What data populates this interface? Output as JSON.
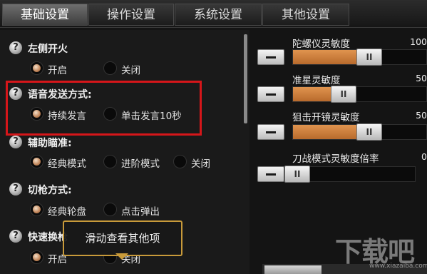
{
  "tabs": [
    {
      "label": "基础设置",
      "active": true
    },
    {
      "label": "操作设置",
      "active": false
    },
    {
      "label": "系统设置",
      "active": false
    },
    {
      "label": "其他设置",
      "active": false
    }
  ],
  "settings": [
    {
      "label": "左侧开火",
      "options": [
        "开启",
        "关闭"
      ],
      "selected": 0
    },
    {
      "label": "语音发送方式:",
      "options": [
        "持续发言",
        "单击发言10秒"
      ],
      "selected": 0,
      "highlighted": true
    },
    {
      "label": "辅助瞄准:",
      "options": [
        "经典模式",
        "进阶模式",
        "关闭"
      ],
      "selected": 0
    },
    {
      "label": "切枪方式:",
      "options": [
        "经典轮盘",
        "点击弹出"
      ],
      "selected": 0
    },
    {
      "label": "快速换枪",
      "options": [
        "开启",
        "关闭"
      ],
      "selected": 0
    }
  ],
  "help_glyph": "?",
  "tooltip": {
    "text": "滑动查看其他项"
  },
  "sliders": [
    {
      "label": "陀螺仪灵敏度",
      "value": "100",
      "fraction": 0.59
    },
    {
      "label": "准星灵敏度",
      "value": "50",
      "fraction": 0.35
    },
    {
      "label": "狙击开镜灵敏度",
      "value": "50",
      "fraction": 0.59
    },
    {
      "label": "刀战模式灵敏度倍率",
      "value": "0",
      "fraction": 0.0
    }
  ],
  "thumb_glyph": "II",
  "watermark": {
    "text": "下载吧",
    "url": "www.xiazaiba.com"
  },
  "colors": {
    "accent": "#d6822f",
    "highlight_box": "#d6161a",
    "tooltip_border": "#c89a3a"
  }
}
